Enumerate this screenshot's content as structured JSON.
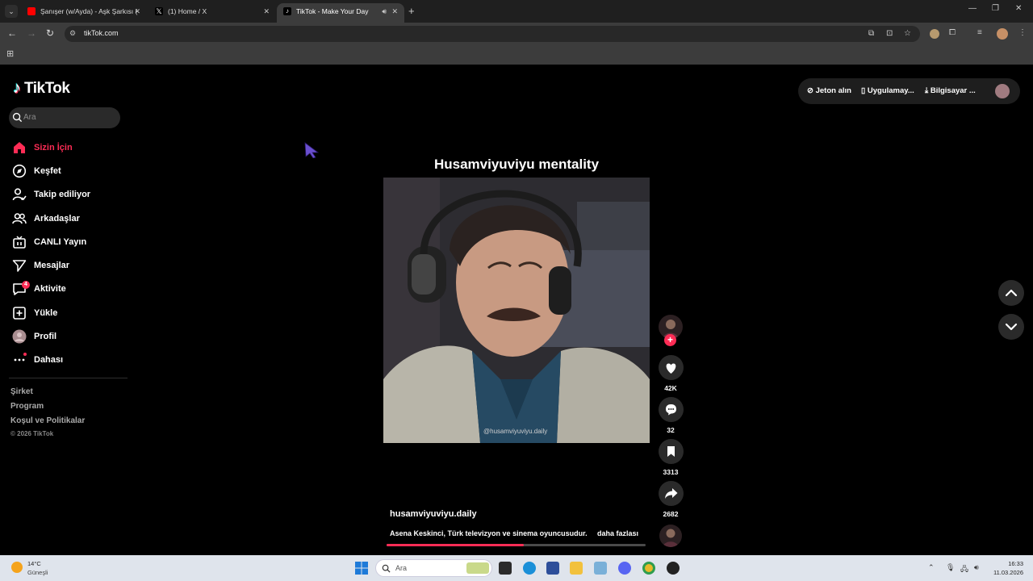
{
  "browser": {
    "tabs": [
      {
        "title": "Şanışer (w/Ayda) - Aşk Şarkısı (",
        "favicon": "youtube-icon",
        "color": "#ff0000"
      },
      {
        "title": "(1) Home / X",
        "favicon": "x-icon",
        "color": "#000000"
      },
      {
        "title": "TikTok - Make Your Day",
        "favicon": "tiktok-icon",
        "color": "#000000",
        "active": true
      }
    ],
    "url": "tikTok.com"
  },
  "tiktok": {
    "brand": "TikTok",
    "search_placeholder": "Ara",
    "nav": [
      {
        "label": "Sizin İçin",
        "icon": "home-icon",
        "active": true
      },
      {
        "label": "Keşfet",
        "icon": "compass-icon"
      },
      {
        "label": "Takip ediliyor",
        "icon": "following-icon"
      },
      {
        "label": "Arkadaşlar",
        "icon": "friends-icon"
      },
      {
        "label": "CANLI Yayın",
        "icon": "live-icon"
      },
      {
        "label": "Mesajlar",
        "icon": "messages-icon"
      },
      {
        "label": "Aktivite",
        "icon": "activity-icon",
        "badge": "4"
      },
      {
        "label": "Yükle",
        "icon": "upload-icon"
      },
      {
        "label": "Profil",
        "icon": "profile-avatar-icon"
      },
      {
        "label": "Dahası",
        "icon": "more-icon",
        "dot": true
      }
    ],
    "footer": {
      "company": "Şirket",
      "program": "Program",
      "terms": "Koşul ve Politikalar",
      "copyright": "© 2026 TikTok"
    },
    "top_actions": {
      "coins": "Jeton alın",
      "app": "Uygulamay...",
      "desktop": "Bilgisayar ..."
    },
    "video": {
      "title": "Husamviyuviyu mentality",
      "watermark": "@husamviyuviyu.daily",
      "author": "husamviyuviyu.daily",
      "description": "Asena Keskinci, Türk televizyon ve sinema oyuncusudur.",
      "more": "daha fazlası",
      "progress": 0.53
    },
    "actions": {
      "likes": "42K",
      "comments": "32",
      "saves": "3313",
      "shares": "2682"
    },
    "accent": "#fe2c55"
  },
  "taskbar": {
    "temperature": "14°C",
    "weather": "Güneşli",
    "search_placeholder": "Ara",
    "time": "16:33",
    "date": "11.03.2026"
  }
}
